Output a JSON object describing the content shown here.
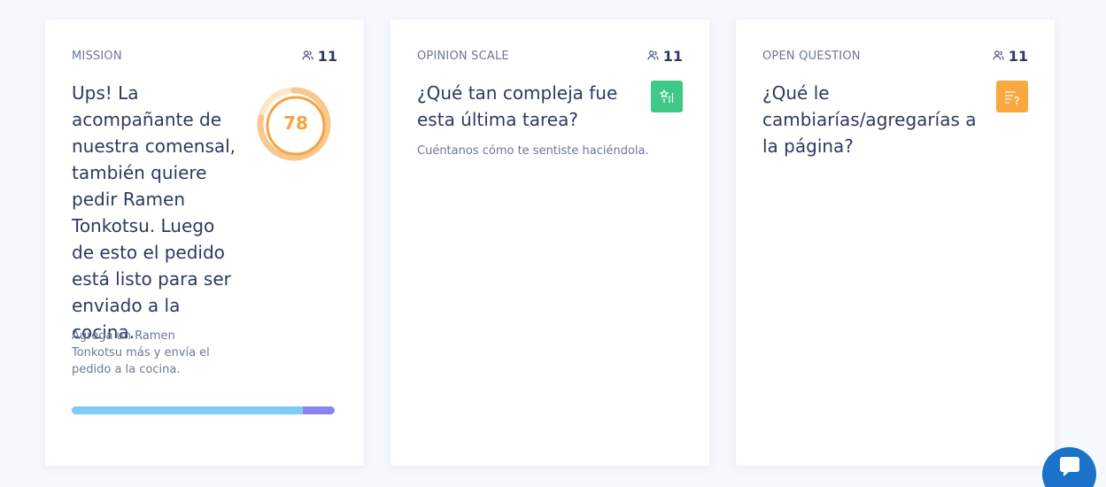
{
  "cards": [
    {
      "type_label": "MISSION",
      "responses": "11",
      "responses_icon": "users-icon",
      "question": "Ups! La acompañante de nuestra comensal, también quiere pedir Ramen Tonkotsu. Luego de esto el pedido está listo para ser enviado a la cocina.",
      "description": "Agrega un Ramen Tonkotsu más y envía el pedido a la cocina.",
      "score": "78",
      "score_color": "#f5a43e",
      "completion_fraction": 0.88,
      "progress_colors": {
        "fill": "#7dccf2",
        "rest": "#8b83ef"
      }
    },
    {
      "type_label": "OPINION SCALE",
      "responses": "11",
      "responses_icon": "users-icon",
      "question": "¿Qué tan compleja fue esta última tarea?",
      "description": "Cuéntanos cómo te sentiste haciéndola.",
      "type_icon": "opinion-scale-icon",
      "icon_color": "#3fc987"
    },
    {
      "type_label": "OPEN QUESTION",
      "responses": "11",
      "responses_icon": "users-icon",
      "question": "¿Qué le cambiarías/agregarías a la página?",
      "type_icon": "open-question-icon",
      "icon_color": "#f7a83e"
    }
  ],
  "chat": {
    "icon": "chat-bubble-icon",
    "color": "#1c72c9"
  }
}
